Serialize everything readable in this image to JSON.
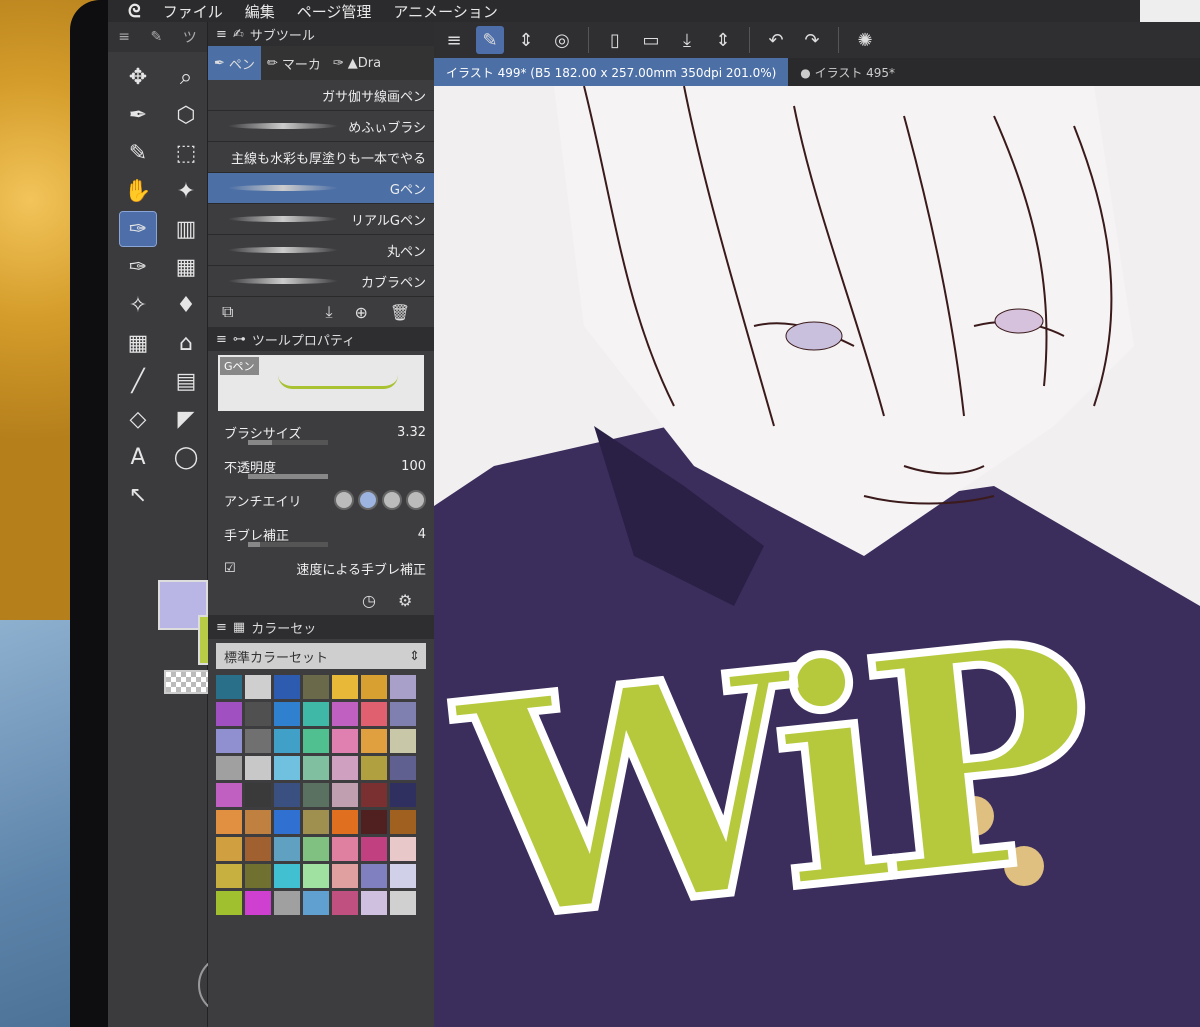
{
  "menu": {
    "logo": "ᘓ",
    "items": [
      "ファイル",
      "編集",
      "ページ管理",
      "アニメーション"
    ]
  },
  "command_icons": [
    "menu-icon",
    "pen-mode-icon",
    "updown-icon",
    "spiral-icon",
    "new-doc-icon",
    "open-icon",
    "save-icon",
    "updown2-icon",
    "undo-icon",
    "redo-icon",
    "loading-icon"
  ],
  "tabs": [
    {
      "label": "イラスト 499* (B5 182.00 x 257.00mm 350dpi 201.0%)",
      "active": true
    },
    {
      "label": "● イラスト 495*",
      "active": false
    }
  ],
  "left_col_header": [
    "≡",
    "✎",
    "ツ"
  ],
  "tools": [
    "✥",
    "⌕",
    "✒",
    "⬡",
    "✎",
    "⬚",
    "✋",
    "✦",
    "✑",
    "▥",
    "✑",
    "▦",
    "✧",
    "♦",
    "▦",
    "⌂",
    "╱",
    "▤",
    "◇",
    "◤",
    "A",
    "◯",
    "↖"
  ],
  "subtool_panel": {
    "title": "サブツール",
    "tabs": [
      {
        "label": "ペン",
        "sel": true
      },
      {
        "label": "マーカ",
        "sel": false
      },
      {
        "label": "▲Dra",
        "sel": false
      }
    ]
  },
  "brushes": [
    {
      "name": "ガサ伽サ線画ペン",
      "sel": false
    },
    {
      "name": "めふぃブラシ",
      "sel": false
    },
    {
      "name": "主線も水彩も厚塗りも一本でやる",
      "sel": false
    },
    {
      "name": "Gペン",
      "sel": true
    },
    {
      "name": "リアルGペン",
      "sel": false
    },
    {
      "name": "丸ペン",
      "sel": false
    },
    {
      "name": "カブラペン",
      "sel": false
    }
  ],
  "tool_property": {
    "title": "ツールプロパティ",
    "preset_name": "Gペン",
    "brush_size_label": "ブラシサイズ",
    "brush_size_value": "3.32",
    "opacity_label": "不透明度",
    "opacity_value": "100",
    "antialias_label": "アンチエイリ",
    "stabilizer_label": "手ブレ補正",
    "stabilizer_value": "4",
    "speed_stabilizer_label": "速度による手ブレ補正"
  },
  "colorset": {
    "title": "カラーセッ",
    "selected": "標準カラーセット",
    "swatches": [
      "#2a6f8a",
      "#cfcfcf",
      "#2d5bb0",
      "#6a6a4a",
      "#e8b838",
      "#d8a030",
      "#a8a0c8",
      "#a050c0",
      "#505050",
      "#3080d0",
      "#40b8a8",
      "#c060c0",
      "#e06070",
      "#8080b0",
      "#9090d0",
      "#707070",
      "#40a0c8",
      "#50c090",
      "#e080b0",
      "#e0a040",
      "#c8c8a8",
      "#a0a0a0",
      "#c8c8c8",
      "#70c0e0",
      "#80c0a0",
      "#d0a0c0",
      "#b0a040",
      "#606090",
      "#c060c0",
      "#3a3a3a",
      "#3a5080",
      "#5a7060",
      "#c0a0b0",
      "#7a3030",
      "#303060",
      "#e09040",
      "#c08040",
      "#3070d0",
      "#a09050",
      "#e07020",
      "#502020",
      "#a06020",
      "#d0a040",
      "#a06030",
      "#60a0c0",
      "#80c080",
      "#e080a0",
      "#c04080",
      "#e8c8c8",
      "#c8b040",
      "#707030",
      "#40c0d0",
      "#a0e0a0",
      "#e0a0a0",
      "#8080c0",
      "#d0d0e8",
      "#a0c030",
      "#d040d0",
      "#a0a0a0",
      "#60a0d0",
      "#c05080",
      "#d0c0e0",
      "#d0d0d0"
    ]
  },
  "canvas_text": {
    "wip": "WiP"
  }
}
